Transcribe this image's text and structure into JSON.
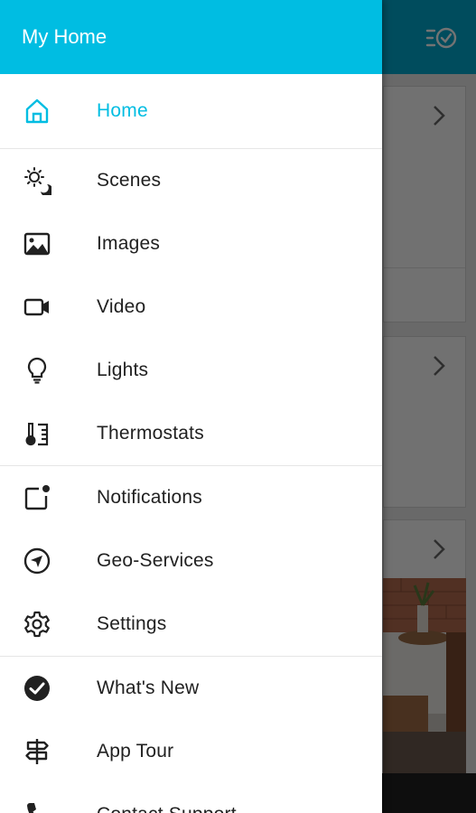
{
  "drawer": {
    "title": "My Home",
    "accent_color": "#00bde2",
    "items": [
      {
        "label": "Home",
        "icon": "home-icon",
        "active": true
      },
      {
        "label": "Scenes",
        "icon": "scenes-icon"
      },
      {
        "label": "Images",
        "icon": "image-icon"
      },
      {
        "label": "Video",
        "icon": "video-camera-icon"
      },
      {
        "label": "Lights",
        "icon": "lightbulb-icon"
      },
      {
        "label": "Thermostats",
        "icon": "thermostat-icon"
      },
      {
        "label": "Notifications",
        "icon": "notification-icon"
      },
      {
        "label": "Geo-Services",
        "icon": "navigation-icon"
      },
      {
        "label": "Settings",
        "icon": "gear-icon"
      },
      {
        "label": "What's New",
        "icon": "check-circle-icon"
      },
      {
        "label": "App Tour",
        "icon": "signpost-icon"
      },
      {
        "label": "Contact Support",
        "icon": "phone-icon"
      }
    ]
  },
  "background": {
    "topbar_icon": "checklist-icon"
  }
}
